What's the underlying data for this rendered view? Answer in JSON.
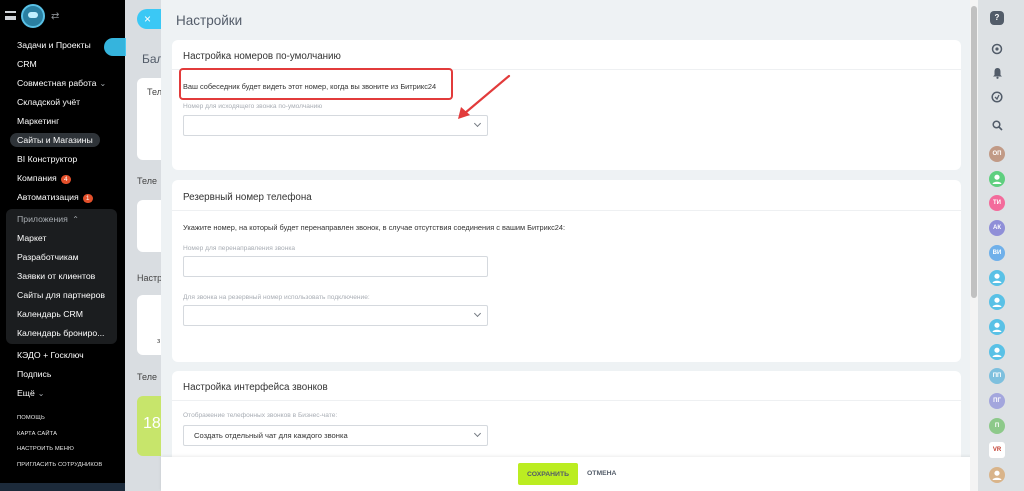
{
  "sidebar": {
    "items": [
      {
        "label": "Задачи и Проекты",
        "badge": null,
        "active": false
      },
      {
        "label": "CRM",
        "badge": null,
        "active": false
      },
      {
        "label": "Совместная работа",
        "badge": null,
        "active": false,
        "chevron": "⌄"
      },
      {
        "label": "Складской учёт",
        "badge": null,
        "active": false
      },
      {
        "label": "Маркетинг",
        "badge": null,
        "active": false
      },
      {
        "label": "Сайты и Магазины",
        "badge": null,
        "active": true
      },
      {
        "label": "BI Конструктор",
        "badge": null,
        "active": false
      },
      {
        "label": "Компания",
        "badge": "4",
        "active": false
      },
      {
        "label": "Автоматизация",
        "badge": "1",
        "active": false
      }
    ],
    "apps_group": {
      "label": "Приложения",
      "chevron": "⌃",
      "items": [
        "Маркет",
        "Разработчикам",
        "Заявки от клиентов",
        "Сайты для партнеров",
        "Календарь CRM",
        "Календарь брониро..."
      ]
    },
    "items_after": [
      "КЭДО + Госключ",
      "Подпись",
      "Ещё"
    ],
    "more_chevron": "⌄",
    "footer_links": [
      "ПОМОЩЬ",
      "КАРТА САЙТА",
      "НАСТРОИТЬ МЕНЮ",
      "ПРИГЛАСИТЬ СОТРУДНИКОВ"
    ]
  },
  "background_page": {
    "fragments": [
      "Бал",
      "Тел",
      "Теле",
      "Настр",
      "Теле",
      "18",
      "з"
    ]
  },
  "slider": {
    "title": "Настройки",
    "close_symbol": "×",
    "sections": {
      "default_number": {
        "title": "Настройка номеров по-умолчанию",
        "hint": "Ваш собеседник будет видеть этот номер, когда вы звоните из Битрикс24",
        "select_label": "Номер для исходящего звонка по-умолчанию",
        "select_value": ""
      },
      "backup_number": {
        "title": "Резервный номер телефона",
        "description": "Укажите номер, на который будет перенаправлен звонок, в случае отсутствия соединения с вашим Битрикс24:",
        "redirect_label": "Номер для перенаправления звонка",
        "redirect_value": "",
        "connection_label": "Для звонка на резервный номер использовать подключение:",
        "connection_value": ""
      },
      "call_interface": {
        "title": "Настройка интерфейса звонков",
        "display_label": "Отображение телефонных звонков в Бизнес-чате:",
        "display_value": "Создать отдельный чат для каждого звонка"
      }
    },
    "buttons": {
      "save": "СОХРАНИТЬ",
      "cancel": "ОТМЕНА"
    }
  },
  "annotation": {
    "highlight_color": "#e23b3b"
  },
  "right_rail": {
    "help": "?",
    "search_symbol": "⚲",
    "avatars": [
      {
        "initials": "ОП",
        "color": "#c19a86"
      },
      {
        "initials": "",
        "color": "#5fcf7f"
      },
      {
        "initials": "ТИ",
        "color": "#f36b9b"
      },
      {
        "initials": "АК",
        "color": "#8f8fd8"
      },
      {
        "initials": "ВИ",
        "color": "#6fb0ea"
      },
      {
        "initials": "",
        "color": "#59c1e6"
      },
      {
        "initials": "",
        "color": "#59c1e6"
      },
      {
        "initials": "",
        "color": "#59c1e6"
      },
      {
        "initials": "",
        "color": "#59c1e6"
      },
      {
        "initials": "ПП",
        "color": "#7ec0de"
      },
      {
        "initials": "ПГ",
        "color": "#a3a6dd"
      },
      {
        "initials": "П",
        "color": "#8dc98a"
      },
      {
        "initials": "VR",
        "color": "#ffffff"
      },
      {
        "initials": "",
        "color": "#d9b48a"
      }
    ]
  }
}
